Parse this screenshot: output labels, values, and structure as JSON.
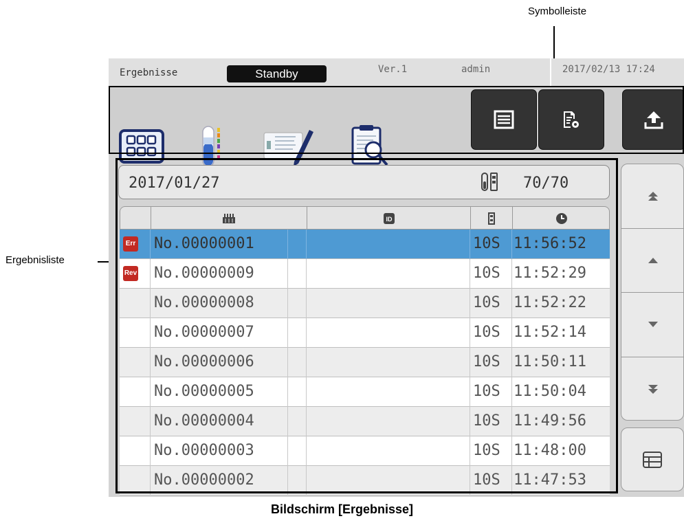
{
  "annotations": {
    "toolbar_label": "Symbolleiste",
    "list_label": "Ergebnisliste",
    "caption": "Bildschirm [Ergebnisse]"
  },
  "status_bar": {
    "screen_title": "Ergebnisse",
    "status": "Standby",
    "version": "Ver.1",
    "user": "admin",
    "datetime": "2017/02/13 17:24"
  },
  "toolbar": {
    "left_icons": [
      "rack-grid-icon",
      "test-tube-icon",
      "edit-sheet-icon",
      "report-search-icon"
    ],
    "right_icons": [
      "list-view-icon",
      "list-settings-icon",
      "upload-icon"
    ]
  },
  "list_header": {
    "date": "2017/01/27",
    "count": "70/70"
  },
  "columns": [
    "status",
    "rack-icon",
    "id-icon",
    "tube-icon",
    "clock-icon"
  ],
  "rows": [
    {
      "badge": "Err",
      "no": "No.00000001",
      "id": "",
      "type": "10S",
      "time": "11:56:52",
      "selected": true
    },
    {
      "badge": "Rev",
      "no": "No.00000009",
      "id": "",
      "type": "10S",
      "time": "11:52:29",
      "selected": false
    },
    {
      "badge": "",
      "no": "No.00000008",
      "id": "",
      "type": "10S",
      "time": "11:52:22",
      "selected": false
    },
    {
      "badge": "",
      "no": "No.00000007",
      "id": "",
      "type": "10S",
      "time": "11:52:14",
      "selected": false
    },
    {
      "badge": "",
      "no": "No.00000006",
      "id": "",
      "type": "10S",
      "time": "11:50:11",
      "selected": false
    },
    {
      "badge": "",
      "no": "No.00000005",
      "id": "",
      "type": "10S",
      "time": "11:50:04",
      "selected": false
    },
    {
      "badge": "",
      "no": "No.00000004",
      "id": "",
      "type": "10S",
      "time": "11:49:56",
      "selected": false
    },
    {
      "badge": "",
      "no": "No.00000003",
      "id": "",
      "type": "10S",
      "time": "11:48:00",
      "selected": false
    },
    {
      "badge": "",
      "no": "No.00000002",
      "id": "",
      "type": "10S",
      "time": "11:47:53",
      "selected": false
    }
  ],
  "side_buttons": [
    "scroll-top-icon",
    "scroll-up-icon",
    "scroll-down-icon",
    "scroll-bottom-icon",
    "table-view-icon"
  ],
  "colors": {
    "selected_row": "#4e9ad3",
    "badge": "#c22a23",
    "toolbar_dark_button": "#333333"
  }
}
